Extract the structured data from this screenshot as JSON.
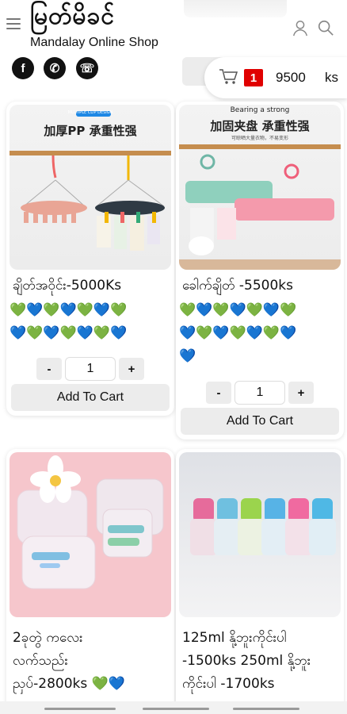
{
  "header": {
    "brand_title": "မြတ်မိခင်",
    "brand_subtitle": "Mandalay Online Shop",
    "icons": [
      "menu-icon",
      "user-icon",
      "search-icon",
      "facebook-icon",
      "phone-icon",
      "viber-icon"
    ]
  },
  "social": {
    "facebook": "f",
    "phone": "✆",
    "viber": "☏"
  },
  "cart": {
    "count": "1",
    "total": "9500",
    "currency": "ks"
  },
  "products": [
    {
      "title": "ချိတ်အဝိုင်း-5000Ks",
      "hearts_line1": "💚💙💚💙💚💙💚",
      "hearts_line2": "💙💚💙💚💙💚💙",
      "hearts_line3": "",
      "image_caption_top": "MULTIPLE CLIP DESIGN",
      "image_caption": "加厚PP 承重性强",
      "qty": "1",
      "add_label": "Add To Cart"
    },
    {
      "title": "ခေါက်ချိတ် -5500ks",
      "hearts_line1": "💚💙💚💙💚💙💚",
      "hearts_line2": "💙💚💙💚💙💚💙",
      "hearts_line3": "💙",
      "image_caption_top": "Bearing a strong",
      "image_caption": "加固夹盘 承重性强",
      "image_caption_small": "可晾晒大量衣物，不易变形",
      "qty": "1",
      "add_label": "Add To Cart"
    },
    {
      "title_line1": "2ခုတွဲ ကလေး",
      "title_line2": "လက်သည်း",
      "title_line3": "ညှပ်-2800ks 💚💙"
    },
    {
      "title_line1": "125ml နို့ဘူးကိုင်းပါ",
      "title_line2": "-1500ks 250ml နို့ဘူး",
      "title_line3": "ကိုင်းပါ -1700ks"
    }
  ],
  "qty_controls": {
    "minus": "-",
    "plus": "+"
  }
}
